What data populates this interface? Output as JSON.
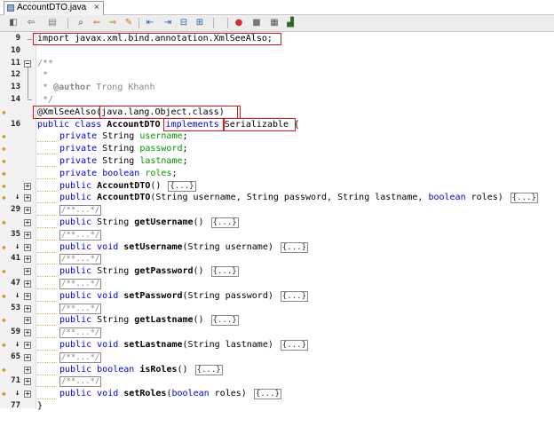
{
  "tab": {
    "label": "AccountDTO.java",
    "close": "×"
  },
  "toolbar": {
    "icons": [
      "last-edit-icon",
      "back-icon",
      "forward-icon",
      "find-icon",
      "find-prev-icon",
      "find-next-icon",
      "toggle-highlight-icon",
      "shift-left-icon",
      "shift-right-icon",
      "comment-icon",
      "uncomment-icon",
      "macro-record-icon",
      "macro-stop-icon",
      "diff-icon",
      "chart-icon"
    ]
  },
  "lines": [
    {
      "num": "9",
      "code": [
        "import javax.xml.bind.annotation.XmlSeeAlso;"
      ]
    },
    {
      "num": "10",
      "code": []
    },
    {
      "num": "11",
      "code": [
        "/**"
      ]
    },
    {
      "num": "12",
      "code": [
        " *"
      ]
    },
    {
      "num": "13",
      "code": [
        " * ",
        "@author",
        " Trong Khanh"
      ]
    },
    {
      "num": "14",
      "code": [
        " */"
      ]
    },
    {
      "num": "",
      "code": [
        "@XmlSeeAlso(",
        "java.lang.Object.class",
        ")"
      ]
    },
    {
      "num": "16",
      "code": [
        "public",
        " ",
        "class",
        " ",
        "AccountDTO",
        " ",
        "implements",
        " Serializable {"
      ]
    },
    {
      "num": "",
      "code": [
        "private",
        " String ",
        "username",
        ";"
      ]
    },
    {
      "num": "",
      "code": [
        "private",
        " String ",
        "password",
        ";"
      ]
    },
    {
      "num": "",
      "code": [
        "private",
        " String ",
        "lastname",
        ";"
      ]
    },
    {
      "num": "",
      "code": [
        "private",
        " ",
        "boolean",
        " ",
        "roles",
        ";"
      ]
    },
    {
      "num": "",
      "code": [
        "public",
        " ",
        "AccountDTO",
        "() ",
        "{...}"
      ]
    },
    {
      "num": "",
      "code": [
        "public",
        " ",
        "AccountDTO",
        "(String username, String password, String lastname, ",
        "boolean",
        " roles) ",
        "{...}"
      ]
    },
    {
      "num": "29",
      "code": [
        "/**...*/"
      ]
    },
    {
      "num": "",
      "code": [
        "public",
        " String ",
        "getUsername",
        "() ",
        "{...}"
      ]
    },
    {
      "num": "35",
      "code": [
        "/**...*/"
      ]
    },
    {
      "num": "",
      "code": [
        "public",
        " ",
        "void",
        " ",
        "setUsername",
        "(String username) ",
        "{...}"
      ]
    },
    {
      "num": "41",
      "code": [
        "/**...*/"
      ]
    },
    {
      "num": "",
      "code": [
        "public",
        " String ",
        "getPassword",
        "() ",
        "{...}"
      ]
    },
    {
      "num": "47",
      "code": [
        "/**...*/"
      ]
    },
    {
      "num": "",
      "code": [
        "public",
        " ",
        "void",
        " ",
        "setPassword",
        "(String password) ",
        "{...}"
      ]
    },
    {
      "num": "53",
      "code": [
        "/**...*/"
      ]
    },
    {
      "num": "",
      "code": [
        "public",
        " String ",
        "getLastname",
        "() ",
        "{...}"
      ]
    },
    {
      "num": "59",
      "code": [
        "/**...*/"
      ]
    },
    {
      "num": "",
      "code": [
        "public",
        " ",
        "void",
        " ",
        "setLastname",
        "(String lastname) ",
        "{...}"
      ]
    },
    {
      "num": "65",
      "code": [
        "/**...*/"
      ]
    },
    {
      "num": "",
      "code": [
        "public",
        " ",
        "boolean",
        " ",
        "isRoles",
        "() ",
        "{...}"
      ]
    },
    {
      "num": "71",
      "code": [
        "/**...*/"
      ]
    },
    {
      "num": "",
      "code": [
        "public",
        " ",
        "void",
        " ",
        "setRoles",
        "(",
        "boolean",
        " roles) ",
        "{...}"
      ]
    },
    {
      "num": "77",
      "code": [
        "}"
      ]
    }
  ],
  "colors": {
    "keyword": "#0000e6",
    "field": "#009900",
    "comment": "#888888",
    "highlight": "#e0141a"
  }
}
